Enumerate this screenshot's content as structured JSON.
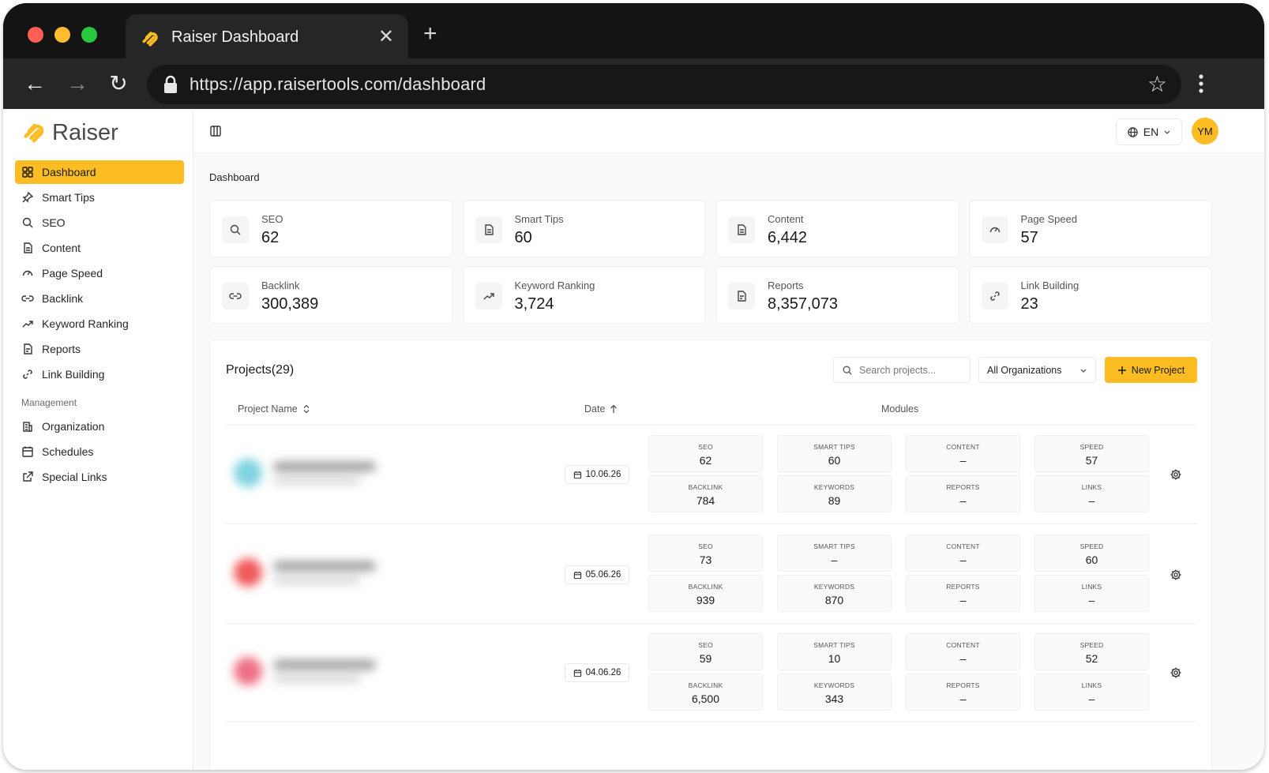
{
  "browser": {
    "tab_title": "Raiser Dashboard",
    "close_glyph": "✕",
    "new_tab_glyph": "+",
    "back_glyph": "←",
    "forward_glyph": "→",
    "reload_glyph": "↻",
    "url": "https://app.raisertools.com/dashboard",
    "bookmark_glyph": "☆"
  },
  "brand": {
    "name": "Raiser",
    "accent": "#fbbd23"
  },
  "sidebar": {
    "items": [
      {
        "label": "Dashboard",
        "icon": "grid-icon",
        "active": true
      },
      {
        "label": "Smart Tips",
        "icon": "pin-icon"
      },
      {
        "label": "SEO",
        "icon": "search-icon"
      },
      {
        "label": "Content",
        "icon": "document-icon"
      },
      {
        "label": "Page Speed",
        "icon": "gauge-icon"
      },
      {
        "label": "Backlink",
        "icon": "link-icon"
      },
      {
        "label": "Keyword Ranking",
        "icon": "trending-icon"
      },
      {
        "label": "Reports",
        "icon": "report-icon"
      },
      {
        "label": "Link Building",
        "icon": "chain-icon"
      }
    ],
    "section_label": "Management",
    "management": [
      {
        "label": "Organization",
        "icon": "building-icon"
      },
      {
        "label": "Schedules",
        "icon": "calendar-icon"
      },
      {
        "label": "Special Links",
        "icon": "external-link-icon"
      }
    ]
  },
  "topbar": {
    "language": "EN",
    "avatar_initials": "YM"
  },
  "breadcrumb": "Dashboard",
  "stats": [
    {
      "label": "SEO",
      "value": "62",
      "icon": "search-icon"
    },
    {
      "label": "Smart Tips",
      "value": "60",
      "icon": "document-icon"
    },
    {
      "label": "Content",
      "value": "6,442",
      "icon": "document-icon"
    },
    {
      "label": "Page Speed",
      "value": "57",
      "icon": "gauge-icon"
    },
    {
      "label": "Backlink",
      "value": "300,389",
      "icon": "link-icon"
    },
    {
      "label": "Keyword Ranking",
      "value": "3,724",
      "icon": "trending-icon"
    },
    {
      "label": "Reports",
      "value": "8,357,073",
      "icon": "report-icon"
    },
    {
      "label": "Link Building",
      "value": "23",
      "icon": "chain-icon"
    }
  ],
  "projects": {
    "title": "Projects(29)",
    "search_placeholder": "Search projects...",
    "org_filter": "All Organizations",
    "new_button": "New Project",
    "columns": {
      "name": "Project Name",
      "date": "Date",
      "modules": "Modules"
    },
    "rows": [
      {
        "date": "10.06.26",
        "avatar_color": "#7fd3e0",
        "modules": [
          {
            "label": "SEO",
            "value": "62"
          },
          {
            "label": "SMART TIPS",
            "value": "60"
          },
          {
            "label": "CONTENT",
            "value": "–"
          },
          {
            "label": "SPEED",
            "value": "57"
          },
          {
            "label": "BACKLINK",
            "value": "784"
          },
          {
            "label": "KEYWORDS",
            "value": "89"
          },
          {
            "label": "REPORTS",
            "value": "–"
          },
          {
            "label": "LINKS",
            "value": "–"
          }
        ]
      },
      {
        "date": "05.06.26",
        "avatar_color": "#f05a5a",
        "modules": [
          {
            "label": "SEO",
            "value": "73"
          },
          {
            "label": "SMART TIPS",
            "value": "–"
          },
          {
            "label": "CONTENT",
            "value": "–"
          },
          {
            "label": "SPEED",
            "value": "60"
          },
          {
            "label": "BACKLINK",
            "value": "939"
          },
          {
            "label": "KEYWORDS",
            "value": "870"
          },
          {
            "label": "REPORTS",
            "value": "–"
          },
          {
            "label": "LINKS",
            "value": "–"
          }
        ]
      },
      {
        "date": "04.06.26",
        "avatar_color": "#ee6f86",
        "modules": [
          {
            "label": "SEO",
            "value": "59"
          },
          {
            "label": "SMART TIPS",
            "value": "10"
          },
          {
            "label": "CONTENT",
            "value": "–"
          },
          {
            "label": "SPEED",
            "value": "52"
          },
          {
            "label": "BACKLINK",
            "value": "6,500"
          },
          {
            "label": "KEYWORDS",
            "value": "343"
          },
          {
            "label": "REPORTS",
            "value": "–"
          },
          {
            "label": "LINKS",
            "value": "–"
          }
        ]
      }
    ]
  }
}
